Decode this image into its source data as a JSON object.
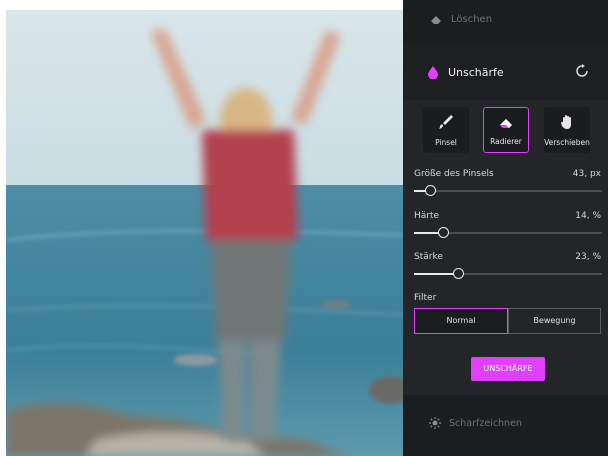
{
  "photo": {
    "description_icon": "blurred-photo-person-on-cliff"
  },
  "panel": {
    "top_item": {
      "label": "Löschen",
      "icon": "eraser-icon"
    },
    "section": {
      "title": "Unschärfe",
      "icon": "droplet-icon",
      "reset_icon": "refresh-icon"
    },
    "tools": [
      {
        "label": "Pinsel",
        "icon": "brush-icon",
        "active": false
      },
      {
        "label": "Radierer",
        "icon": "eraser-icon",
        "active": true
      },
      {
        "label": "Verschieben",
        "icon": "hand-icon",
        "active": false
      }
    ],
    "sliders": [
      {
        "label": "Größe des Pinsels",
        "value": "43, px",
        "fraction": 0.09
      },
      {
        "label": "Härte",
        "value": "14, %",
        "fraction": 0.16
      },
      {
        "label": "Stärke",
        "value": "23, %",
        "fraction": 0.24
      }
    ],
    "filter": {
      "label": "Filter",
      "options": [
        "Normal",
        "Bewegung"
      ],
      "selected": "Normal"
    },
    "apply_label": "UNSCHÄRFE",
    "footer_item": {
      "label": "Scharfzeichnen",
      "icon": "sun-icon"
    }
  },
  "colors": {
    "accent": "#e040fb",
    "panel_bg": "#232529",
    "panel_dark": "#1c1d20"
  }
}
